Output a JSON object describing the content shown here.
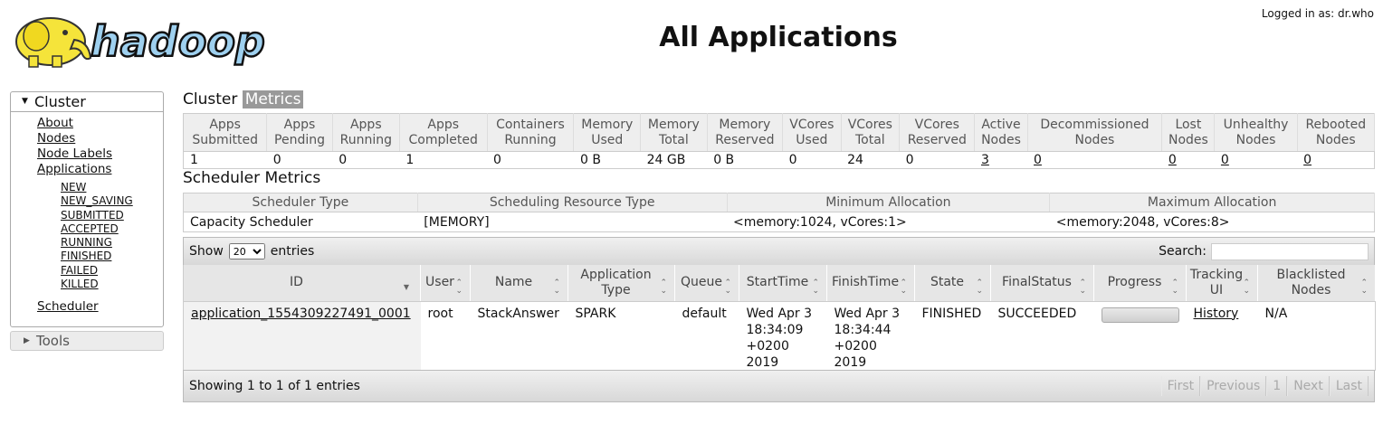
{
  "header": {
    "logo_text": "hadoop",
    "title": "All Applications",
    "login": "Logged in as: dr.who"
  },
  "sidebar": {
    "cluster_label": "Cluster",
    "links": [
      "About",
      "Nodes",
      "Node Labels",
      "Applications"
    ],
    "app_states": [
      "NEW",
      "NEW_SAVING",
      "SUBMITTED",
      "ACCEPTED",
      "RUNNING",
      "FINISHED",
      "FAILED",
      "KILLED"
    ],
    "scheduler": "Scheduler",
    "tools_label": "Tools"
  },
  "cluster_metrics": {
    "title_a": "Cluster",
    "title_b": "Metrics",
    "headers": [
      [
        "Apps",
        "Submitted"
      ],
      [
        "Apps",
        "Pending"
      ],
      [
        "Apps",
        "Running"
      ],
      [
        "Apps",
        "Completed"
      ],
      [
        "Containers",
        "Running"
      ],
      [
        "Memory",
        "Used"
      ],
      [
        "Memory",
        "Total"
      ],
      [
        "Memory",
        "Reserved"
      ],
      [
        "VCores",
        "Used"
      ],
      [
        "VCores",
        "Total"
      ],
      [
        "VCores",
        "Reserved"
      ],
      [
        "Active",
        "Nodes"
      ],
      [
        "Decommissioned",
        "Nodes"
      ],
      [
        "Lost",
        "Nodes"
      ],
      [
        "Unhealthy",
        "Nodes"
      ],
      [
        "Rebooted",
        "Nodes"
      ]
    ],
    "values": [
      "1",
      "0",
      "0",
      "1",
      "0",
      "0 B",
      "24 GB",
      "0 B",
      "0",
      "24",
      "0",
      "3",
      "0",
      "0",
      "0",
      "0"
    ],
    "links": [
      false,
      false,
      false,
      false,
      false,
      false,
      false,
      false,
      false,
      false,
      false,
      true,
      true,
      true,
      true,
      true
    ]
  },
  "scheduler_metrics": {
    "title": "Scheduler Metrics",
    "headers": [
      "Scheduler Type",
      "Scheduling Resource Type",
      "Minimum Allocation",
      "Maximum Allocation"
    ],
    "values": [
      "Capacity Scheduler",
      "[MEMORY]",
      "<memory:1024, vCores:1>",
      "<memory:2048, vCores:8>"
    ]
  },
  "datatable": {
    "show_label": "Show",
    "page_size": "20",
    "entries_label": "entries",
    "search_label": "Search:",
    "search_value": "",
    "columns": [
      [
        "ID"
      ],
      [
        "User"
      ],
      [
        "Name"
      ],
      [
        "Application",
        "Type"
      ],
      [
        "Queue"
      ],
      [
        "StartTime"
      ],
      [
        "FinishTime"
      ],
      [
        "State"
      ],
      [
        "FinalStatus"
      ],
      [
        "Progress"
      ],
      [
        "Tracking",
        "UI"
      ],
      [
        "Blacklisted",
        "Nodes"
      ]
    ],
    "rows": [
      {
        "id": "application_1554309227491_0001",
        "user": "root",
        "name": "StackAnswer",
        "type": "SPARK",
        "queue": "default",
        "start": [
          "Wed Apr 3",
          "18:34:09",
          "+0200",
          "2019"
        ],
        "finish": [
          "Wed Apr 3",
          "18:34:44",
          "+0200",
          "2019"
        ],
        "state": "FINISHED",
        "final_status": "SUCCEEDED",
        "progress": 0,
        "tracking": "History",
        "blacklisted": "N/A"
      }
    ],
    "info": "Showing 1 to 1 of 1 entries",
    "pager": [
      "First",
      "Previous",
      "1",
      "Next",
      "Last"
    ]
  }
}
